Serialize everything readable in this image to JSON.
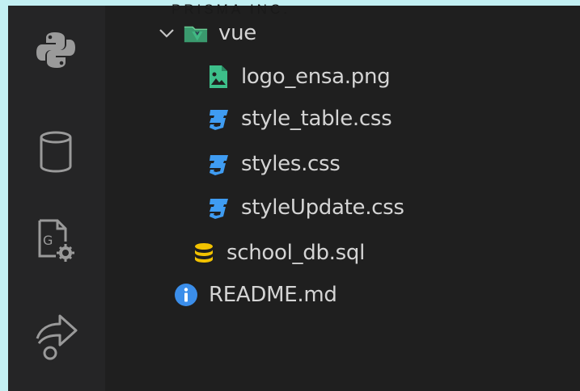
{
  "brand": "PRISMA INC.",
  "activity_bar": {
    "icons": [
      "python-icon",
      "database-icon",
      "file-settings-icon",
      "remote-share-icon"
    ]
  },
  "explorer": {
    "folder": {
      "name": "vue",
      "expanded": true
    },
    "files": [
      {
        "name": "logo_ensa.png",
        "icon": "image-file-icon"
      },
      {
        "name": "style_table.css",
        "icon": "css-file-icon"
      },
      {
        "name": "styles.css",
        "icon": "css-file-icon"
      },
      {
        "name": "styleUpdate.css",
        "icon": "css-file-icon"
      }
    ],
    "root_files": [
      {
        "name": "school_db.sql",
        "icon": "sql-database-icon"
      },
      {
        "name": "README.md",
        "icon": "info-icon"
      }
    ]
  },
  "colors": {
    "page_background": "#c3f0f3",
    "editor_background": "#1f1f1f",
    "activity_bar_background": "#252526",
    "text": "#d4d4d4",
    "css_icon": "#3f9cf2",
    "image_icon": "#3dbf8a",
    "sql_icon": "#f2c200",
    "info_icon": "#3b8eea"
  }
}
